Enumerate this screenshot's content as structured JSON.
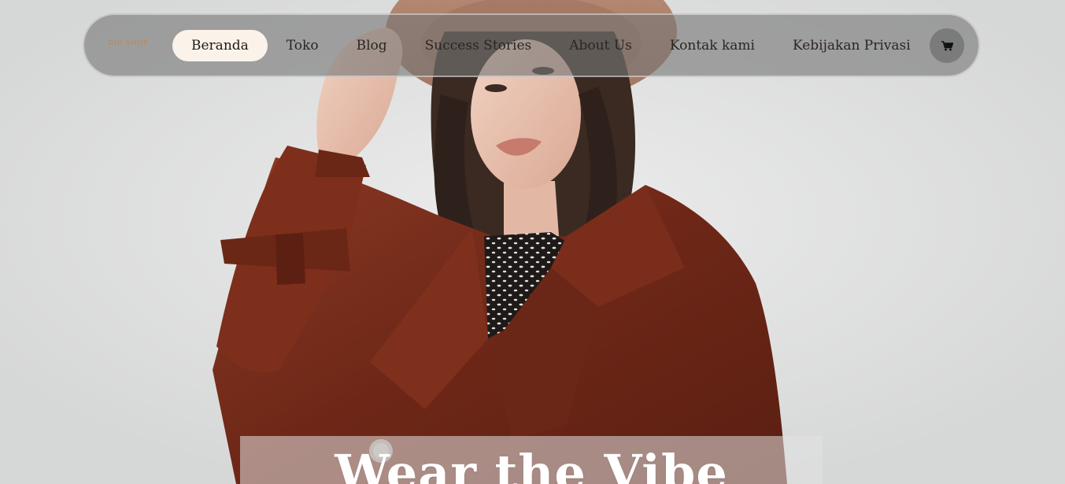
{
  "site": {
    "logo_text": "DIB SHOP"
  },
  "nav": {
    "items": [
      {
        "label": "Beranda",
        "active": true
      },
      {
        "label": "Toko",
        "active": false
      },
      {
        "label": "Blog",
        "active": false
      },
      {
        "label": "Success Stories",
        "active": false
      },
      {
        "label": "About Us",
        "active": false
      },
      {
        "label": "Kontak kami",
        "active": false
      },
      {
        "label": "Kebijakan Privasi",
        "active": false
      }
    ],
    "cart_icon": "shopping-cart-icon"
  },
  "hero": {
    "headline": "Wear the Vibe",
    "image_description": "model-in-hat-and-rust-trench-coat"
  },
  "colors": {
    "nav_background": "#787878",
    "active_pill": "#fbf3ea",
    "coat": "#7a2e1c",
    "hat": "#c49a82",
    "headline": "#ffffff"
  }
}
